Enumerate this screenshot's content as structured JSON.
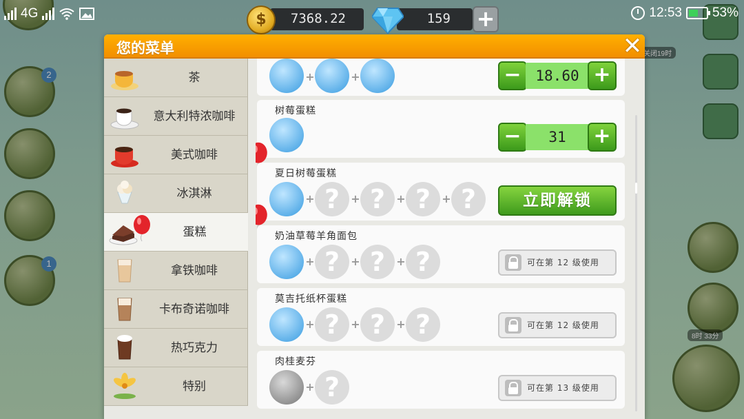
{
  "status_bar": {
    "network": "4G",
    "time": "12:53",
    "battery": "53%",
    "battery_level": 0.53
  },
  "currency": {
    "coins": "7368.22",
    "gems": "159",
    "add_label": "+"
  },
  "dialog": {
    "title": "您的菜单",
    "close_label": "✕"
  },
  "categories": [
    {
      "label": "茶",
      "icon": "tea-cup-icon",
      "active": false
    },
    {
      "label": "意大利特浓咖啡",
      "icon": "espresso-cup-icon",
      "active": false
    },
    {
      "label": "美式咖啡",
      "icon": "americano-cup-icon",
      "active": false
    },
    {
      "label": "冰淇淋",
      "icon": "ice-cream-icon",
      "active": false
    },
    {
      "label": "蛋糕",
      "icon": "cake-icon",
      "active": true
    },
    {
      "label": "拿铁咖啡",
      "icon": "latte-glass-icon",
      "active": false
    },
    {
      "label": "卡布奇诺咖啡",
      "icon": "cappuccino-glass-icon",
      "active": false
    },
    {
      "label": "热巧克力",
      "icon": "hot-chocolate-icon",
      "active": false
    },
    {
      "label": "特别",
      "icon": "special-flower-icon",
      "active": false
    }
  ],
  "items": [
    {
      "name": "",
      "price": "18.60",
      "ingredients": [
        "croissant-icon",
        "ice-cream-icon",
        "chocolate-bar-icon"
      ]
    },
    {
      "name": "树莓蛋糕",
      "price": "31",
      "ingredients": [
        "raspberry-cake-icon"
      ]
    },
    {
      "name": "夏日树莓蛋糕",
      "action": "立即解锁",
      "ingredients": [
        "raspberry-cake-icon",
        "unknown",
        "unknown",
        "unknown",
        "unknown"
      ]
    },
    {
      "name": "奶油草莓羊角面包",
      "locked": "可在第 12 级使用",
      "ingredients": [
        "croissant-icon",
        "unknown",
        "unknown",
        "unknown"
      ]
    },
    {
      "name": "莫吉托纸杯蛋糕",
      "locked": "可在第 12 级使用",
      "ingredients": [
        "cupcake-icon",
        "unknown",
        "unknown",
        "unknown"
      ]
    },
    {
      "name": "肉桂麦芬",
      "locked": "可在第 13 级使用",
      "ingredients": [
        "muffin-icon",
        "unknown"
      ]
    }
  ],
  "stepper": {
    "minus": "−",
    "plus": "+"
  },
  "unknown_glyph": "?",
  "plus_glyph": "+",
  "background": {
    "badge_books": "2",
    "badge_gift": "1",
    "timer_top": "关闭19时",
    "timer_bottom": "8时 33分"
  }
}
